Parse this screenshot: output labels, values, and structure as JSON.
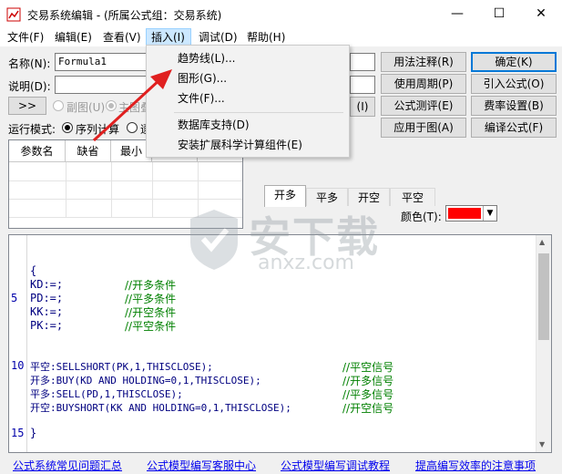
{
  "window": {
    "title": "交易系统编辑 - (所属公式组：交易系统)",
    "minimize": "—",
    "maximize": "☐",
    "close": "✕"
  },
  "menubar": [
    {
      "label": "文件(F)"
    },
    {
      "label": "编辑(E)"
    },
    {
      "label": "查看(V)"
    },
    {
      "label": "插入(I)"
    },
    {
      "label": "调试(D)"
    },
    {
      "label": "帮助(H)"
    }
  ],
  "insert_menu": {
    "items": [
      "趋势线(L)...",
      "图形(G)...",
      "文件(F)...",
      "数据库支持(D)",
      "安装扩展科学计算组件(E)"
    ]
  },
  "form": {
    "name_label": "名称(N):",
    "name_value": "Formula1",
    "desc_label": "说明(D):",
    "desc_value": "",
    "toggle_button": ">>",
    "sub_chart_label": "副图(U)",
    "main_chart_label": "主图叠",
    "run_mode_label": "运行模式:",
    "sequential_label": "序列计算",
    "other_mode_label": "逐",
    "hidden_btn_label": "(I)"
  },
  "buttons": {
    "usage_note": "用法注释(R)",
    "confirm": "确定(K)",
    "use_period": "使用周期(P)",
    "import_formula": "引入公式(O)",
    "formula_test": "公式测评(E)",
    "fee_settings": "费率设置(B)",
    "apply_to_chart": "应用于图(A)",
    "compile": "编译公式(F)"
  },
  "param_table": {
    "headers": [
      "参数名",
      "缺省",
      "最小"
    ]
  },
  "tabs": [
    "开多",
    "平多",
    "开空",
    "平空"
  ],
  "color": {
    "label": "颜色(T):",
    "value": "#ff0000"
  },
  "editor": {
    "line_numbers": [
      {
        "n": "5"
      },
      {
        "n": "10"
      },
      {
        "n": "15"
      }
    ],
    "lines": [
      {
        "code": "{",
        "comment": ""
      },
      {
        "code": "KD:=;",
        "comment": "//开多条件"
      },
      {
        "code": "PD:=;",
        "comment": "//平多条件"
      },
      {
        "code": "KK:=;",
        "comment": "//开空条件"
      },
      {
        "code": "PK:=;",
        "comment": "//平空条件"
      },
      {
        "code": "平空:SELLSHORT(PK,1,THISCLOSE);",
        "comment": "//平空信号"
      },
      {
        "code": "开多:BUY(KD AND HOLDING=0,1,THISCLOSE);",
        "comment": "//开多信号"
      },
      {
        "code": "平多:SELL(PD,1,THISCLOSE);",
        "comment": "//平多信号"
      },
      {
        "code": "开空:BUYSHORT(KK AND HOLDING=0,1,THISCLOSE);",
        "comment": "//开空信号"
      },
      {
        "code": "}",
        "comment": ""
      }
    ]
  },
  "footer_links": [
    "公式系统常见问题汇总",
    "公式模型编写客服中心",
    "公式模型编写调试教程",
    "提高编写效率的注意事项"
  ],
  "watermark": {
    "text": "安下载",
    "sub": "anxz.com"
  }
}
